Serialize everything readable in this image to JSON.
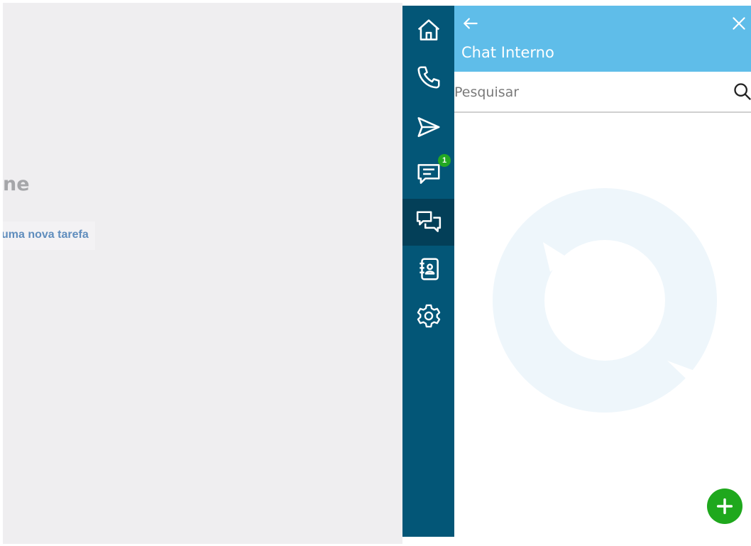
{
  "background": {
    "heading_fragment": "ne",
    "link_fragment": "uma nova tarefa"
  },
  "rail": {
    "items": [
      {
        "name": "home",
        "icon": "home-icon"
      },
      {
        "name": "phone",
        "icon": "phone-icon"
      },
      {
        "name": "send",
        "icon": "send-icon"
      },
      {
        "name": "messages",
        "icon": "message-icon",
        "badge": "1"
      },
      {
        "name": "internal-chat",
        "icon": "chat-bubbles-icon",
        "active": true
      },
      {
        "name": "contacts",
        "icon": "contacts-book-icon"
      },
      {
        "name": "settings",
        "icon": "gear-icon"
      }
    ]
  },
  "panel": {
    "title": "Chat Interno",
    "search_placeholder": "Pesquisar",
    "search_value": ""
  },
  "colors": {
    "rail_bg": "#035677",
    "rail_active": "#033f58",
    "header_bg": "#5fbde9",
    "fab_bg": "#1fa81d",
    "badge_bg": "#23a823"
  }
}
